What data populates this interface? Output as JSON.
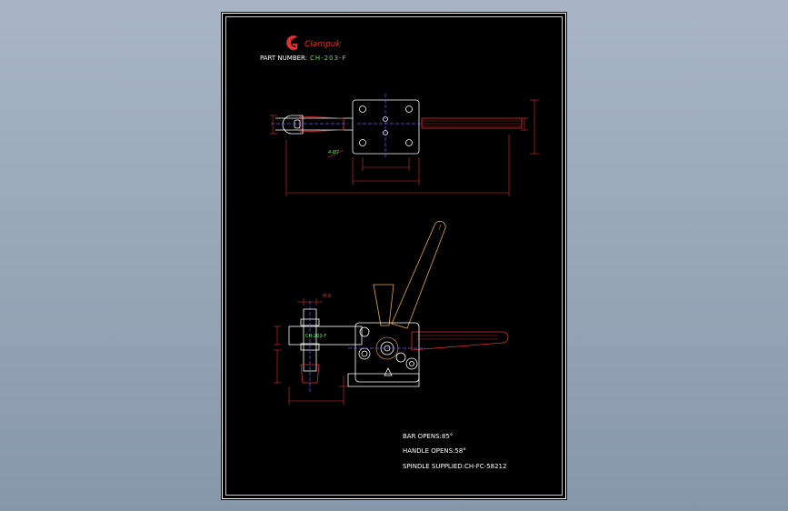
{
  "title_block": {
    "logo_text": "Clampuk",
    "part_number_label": "PART NUMBER:",
    "part_number_value": "CH-203-F"
  },
  "top_view": {
    "hole_callout": "4-Ø7"
  },
  "side_view": {
    "body_marking": "CH-203-F",
    "thread_label": "M 8"
  },
  "notes": [
    "BAR OPENS:85°",
    "HANDLE OPENS:58°",
    "SPINDLE SUPPLIED:CH-FC-58212"
  ],
  "colors": {
    "sheet": "#000000",
    "border": "#ffffff",
    "outline": "#ffffff",
    "dimension": "#e03030",
    "handle": "#e6a84a",
    "centerline": "#7a55ff",
    "label_green": "#3cff3c",
    "background": "#95a3b5"
  }
}
